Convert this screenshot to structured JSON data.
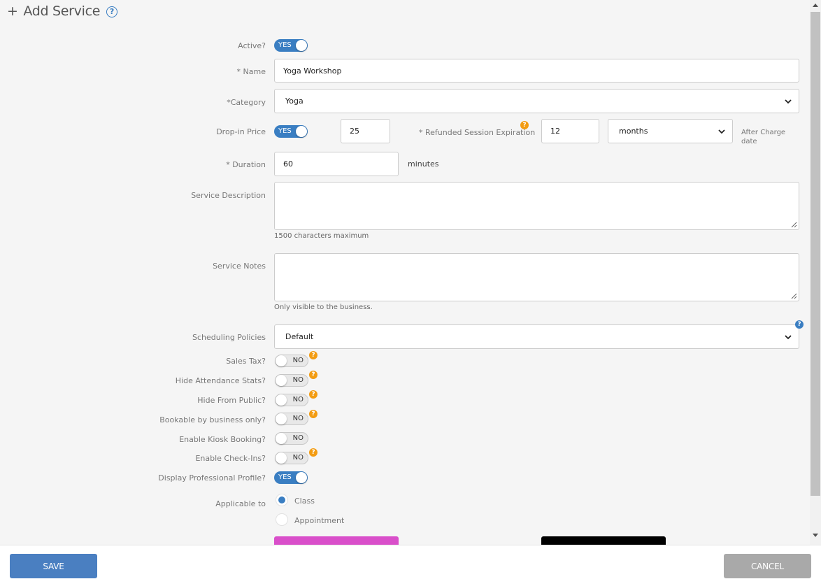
{
  "header": {
    "title": "Add Service",
    "plus": "+",
    "help_glyph": "?"
  },
  "form": {
    "active": {
      "label": "Active?",
      "state": "YES"
    },
    "name": {
      "label": "* Name",
      "value": "Yoga Workshop"
    },
    "category": {
      "label": "*Category",
      "value": "Yoga"
    },
    "dropin": {
      "label": "Drop-in Price",
      "state": "YES",
      "price": "25",
      "refund_label": "* Refunded Session Expiration",
      "refund_value": "12",
      "unit": "months",
      "after_charge": "After Charge date"
    },
    "duration": {
      "label": "* Duration",
      "value": "60",
      "unit": "minutes"
    },
    "description": {
      "label": "Service Description",
      "hint": "1500 characters maximum"
    },
    "notes": {
      "label": "Service Notes",
      "hint": "Only visible to the business."
    },
    "scheduling": {
      "label": "Scheduling Policies",
      "value": "Default"
    },
    "toggles": [
      {
        "label": "Sales Tax?",
        "state": "NO"
      },
      {
        "label": "Hide Attendance Stats?",
        "state": "NO"
      },
      {
        "label": "Hide From Public?",
        "state": "NO"
      },
      {
        "label": "Bookable by business only?",
        "state": "NO"
      },
      {
        "label": "Enable Kiosk Booking?",
        "state": "NO"
      },
      {
        "label": "Enable Check-Ins?",
        "state": "NO"
      },
      {
        "label": "Display Professional Profile?",
        "state": "YES"
      }
    ],
    "applicable": {
      "label": "Applicable to",
      "options": [
        "Class",
        "Appointment"
      ],
      "selected": "Class"
    },
    "swatch_colors": [
      "#d94fca",
      "#000000"
    ]
  },
  "footer": {
    "save": "SAVE",
    "cancel": "CANCEL"
  },
  "colors": {
    "accent": "#3a7ec2",
    "save_button": "#4a7fc1",
    "cancel_button": "#a9a9a9",
    "help_orange": "#f39c12"
  }
}
